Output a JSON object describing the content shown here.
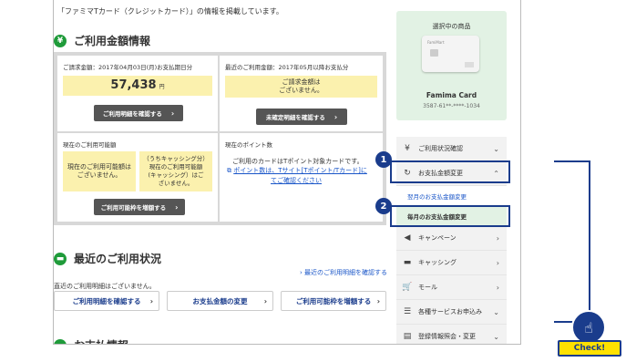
{
  "intro": "「ファミマTカード（クレジットカード）」の情報を掲載しています。",
  "section1": {
    "icon": "¥",
    "title": "ご利用金額情報"
  },
  "billing": {
    "header": "ご請求金額：2017年04月03日(月)お支払期日分",
    "amount": "57,438",
    "unit": "円",
    "button": "ご利用明細を確認する"
  },
  "recent": {
    "header": "最近のご利用金額：2017年05月以降お支払分",
    "message_line1": "ご請求金額は",
    "message_line2": "ございません。",
    "button": "未確定明細を確認する"
  },
  "available": {
    "header": "現在のご利用可能額",
    "left_line1": "現在のご利用可能額は",
    "left_line2": "ございません。",
    "right_line1": "（うちキャッシング分）",
    "right_line2": "現在のご利用可能額",
    "right_line3": "(キャッシング）はご",
    "right_line4": "ざいません。",
    "button": "ご利用可能枠を増額する"
  },
  "points": {
    "header": "現在のポイント数",
    "text": "ご利用のカードはTポイント対象カードです。",
    "link_line1": "ポイント数は、Tサイト[Tポイント/Tカード]に",
    "link_line2": "てご確認ください"
  },
  "section2": {
    "icon": "▬",
    "title": "最近のご利用状況"
  },
  "history_link": "最近のご利用明細を確認する",
  "no_history": "直近のご利用明細はございません。",
  "buttons": [
    "ご利用明細を確認する",
    "お支払金額の変更",
    "ご利用可能枠を増額する"
  ],
  "section3_title": "お支払情報",
  "sidebar": {
    "card_title": "選択中の商品",
    "card_name": "Famima Card",
    "card_number": "3587-61**-****-1034",
    "card_face_text": "FamiMart"
  },
  "menu": [
    {
      "icon": "¥",
      "label": "ご利用状況確認"
    },
    {
      "icon": "↻",
      "label": "お支払金額変更"
    },
    {
      "label": "翌月のお支払金額変更"
    },
    {
      "label": "毎月のお支払金額変更"
    },
    {
      "icon": "◀",
      "label": "キャンペーン"
    },
    {
      "icon": "▬",
      "label": "キャッシング"
    },
    {
      "icon": "🛒",
      "label": "モール"
    },
    {
      "icon": "☰",
      "label": "各種サービスお申込み"
    },
    {
      "icon": "▤",
      "label": "登録情報照会・変更"
    }
  ],
  "badges": [
    "1",
    "2"
  ],
  "check_label": "Check!",
  "colors": {
    "accent": "#1a3c8c",
    "green": "#1f9b3a",
    "yellow": "#fbf1ae",
    "check": "#ffe100"
  }
}
